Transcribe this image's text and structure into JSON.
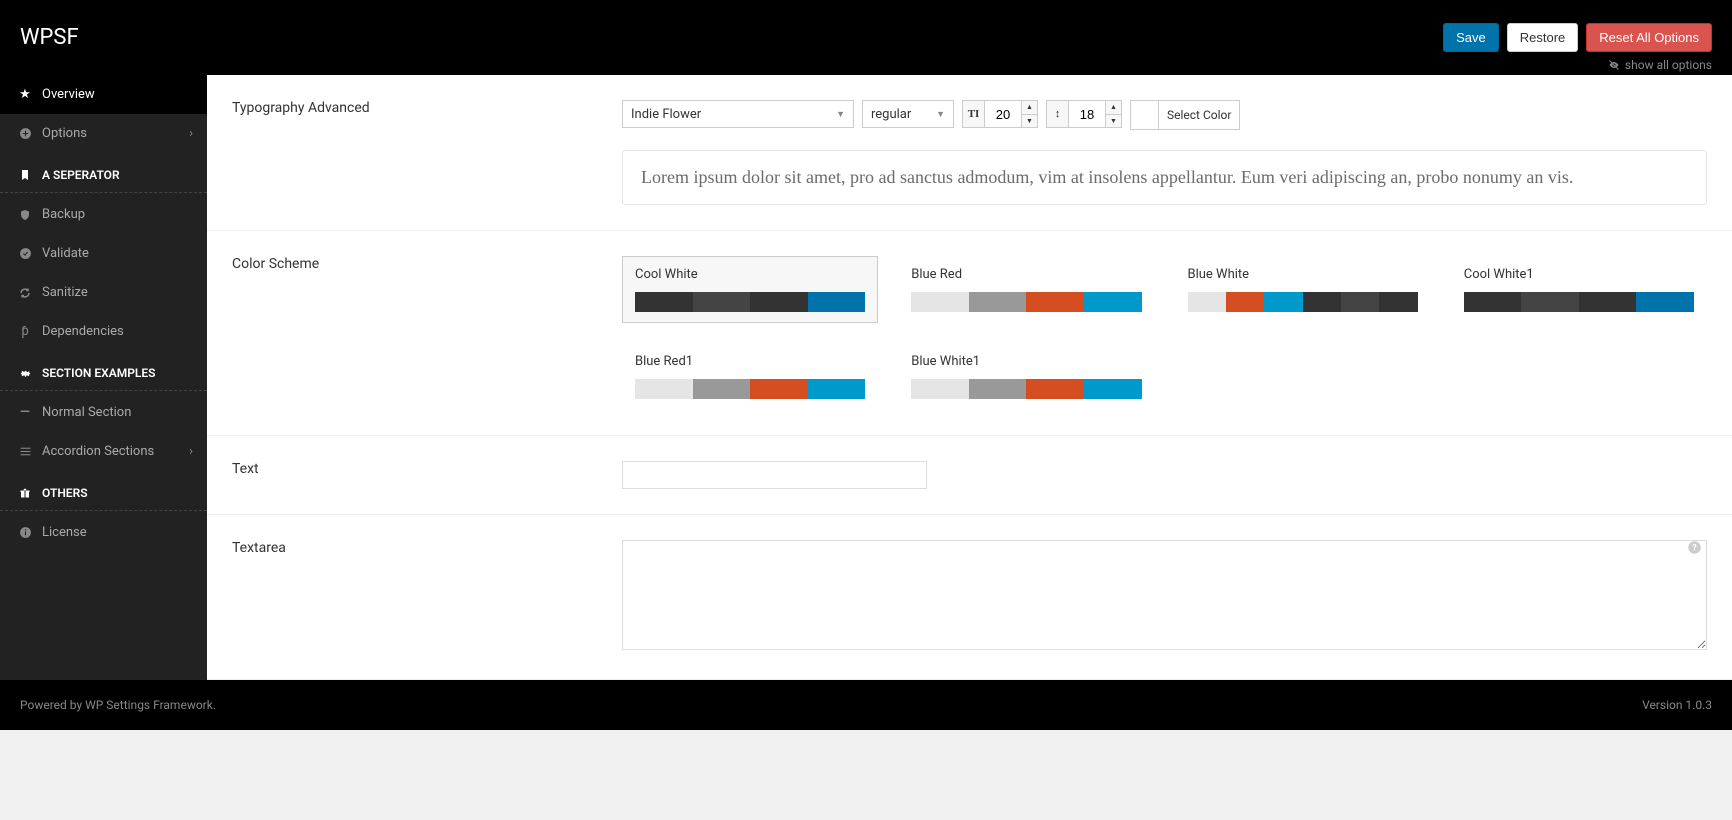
{
  "header": {
    "brand": "WPSF",
    "save": "Save",
    "restore": "Restore",
    "reset": "Reset All Options",
    "show_all": "show all options"
  },
  "sidebar": {
    "overview": "Overview",
    "options": "Options",
    "sep1": "A SEPERATOR",
    "backup": "Backup",
    "validate": "Validate",
    "sanitize": "Sanitize",
    "dependencies": "Dependencies",
    "sep2": "SECTION EXAMPLES",
    "normal": "Normal Section",
    "accordion": "Accordion Sections",
    "sep3": "OTHERS",
    "license": "License"
  },
  "fields": {
    "typography": {
      "label": "Typography Advanced",
      "font": "Indie Flower",
      "weight": "regular",
      "size": "20",
      "lineheight": "18",
      "select_color": "Select Color",
      "preview": "Lorem ipsum dolor sit amet, pro ad sanctus admodum, vim at insolens appellantur. Eum veri adipiscing an, probo nonumy an vis."
    },
    "color_scheme": {
      "label": "Color Scheme",
      "options": [
        {
          "name": "Cool White",
          "colors": [
            "#333333",
            "#444444",
            "#333333",
            "#0073aa"
          ],
          "selected": true
        },
        {
          "name": "Blue Red",
          "colors": [
            "#e5e5e5",
            "#999999",
            "#d54e21",
            "#0099cc"
          ],
          "selected": false
        },
        {
          "name": "Blue White",
          "colors": [
            "#e5e5e5",
            "#d54e21",
            "#0099cc",
            "#333333",
            "#444444",
            "#333333"
          ],
          "selected": false
        },
        {
          "name": "Cool White1",
          "colors": [
            "#333333",
            "#444444",
            "#333333",
            "#0073aa"
          ],
          "selected": false
        },
        {
          "name": "Blue Red1",
          "colors": [
            "#e5e5e5",
            "#999999",
            "#d54e21",
            "#0099cc"
          ],
          "selected": false
        },
        {
          "name": "Blue White1",
          "colors": [
            "#e5e5e5",
            "#999999",
            "#d54e21",
            "#0099cc"
          ],
          "selected": false
        }
      ]
    },
    "text": {
      "label": "Text",
      "value": ""
    },
    "textarea": {
      "label": "Textarea",
      "value": ""
    }
  },
  "footer": {
    "left": "Powered by WP Settings Framework.",
    "right": "Version 1.0.3"
  }
}
